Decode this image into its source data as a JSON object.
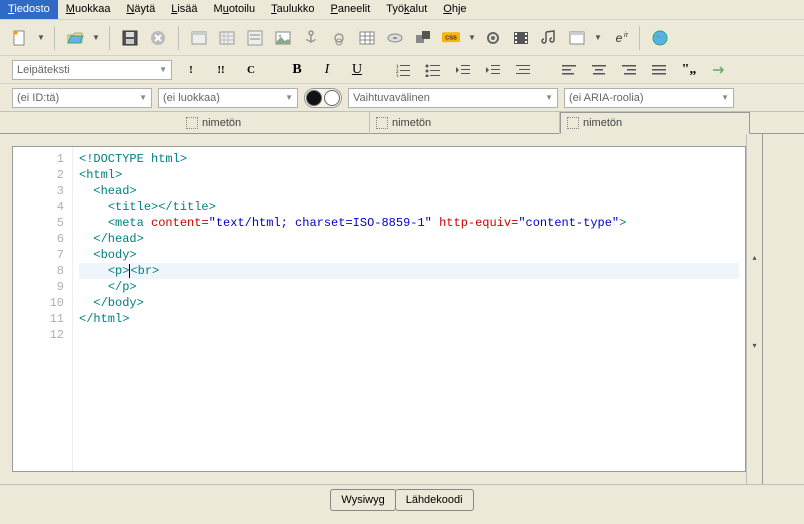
{
  "menubar": [
    {
      "label": "Tiedosto",
      "u": 0,
      "active": true
    },
    {
      "label": "Muokkaa",
      "u": 0
    },
    {
      "label": "Näytä",
      "u": 0
    },
    {
      "label": "Lisää",
      "u": 0
    },
    {
      "label": "Muotoilu",
      "u": 1
    },
    {
      "label": "Taulukko",
      "u": 0
    },
    {
      "label": "Paneelit",
      "u": 0
    },
    {
      "label": "Työkalut",
      "u": 3
    },
    {
      "label": "Ohje",
      "u": 0
    }
  ],
  "paragraph_style": "Leipäteksti",
  "id_field": "(ei ID:tä)",
  "class_field": "(ei luokkaa)",
  "width_field": "Vaihtuvavälinen",
  "aria_field": "(ei ARIA-roolia)",
  "tabs": [
    "nimetön",
    "nimetön",
    "nimetön"
  ],
  "active_tab": 2,
  "bottom_buttons": [
    "Wysiwyg",
    "Lähdekoodi"
  ],
  "code_lines": [
    {
      "n": 1,
      "html": "&lt;!DOCTYPE html&gt;",
      "cls": "tag"
    },
    {
      "n": 2,
      "html": "<span class='tag'>&lt;html&gt;</span>"
    },
    {
      "n": 3,
      "html": "  <span class='tag'>&lt;head&gt;</span>"
    },
    {
      "n": 4,
      "html": "    <span class='tag'>&lt;title&gt;&lt;/title&gt;</span>"
    },
    {
      "n": 5,
      "html": "    <span class='tag'>&lt;meta</span> <span class='attr'>content=</span><span class='str'>\"text/html; charset=ISO-8859-1\"</span> <span class='attr'>http-equiv=</span><span class='str'>\"content-type\"</span><span class='tag'>&gt;</span>"
    },
    {
      "n": 6,
      "html": "  <span class='tag'>&lt;/head&gt;</span>"
    },
    {
      "n": 7,
      "html": "  <span class='tag'>&lt;body&gt;</span>"
    },
    {
      "n": 8,
      "html": "    <span class='tag'>&lt;p&gt;</span><span class='cursor'></span><span class='tag'>&lt;br&gt;</span>",
      "hl": true
    },
    {
      "n": 9,
      "html": "    <span class='tag'>&lt;/p&gt;</span>"
    },
    {
      "n": 10,
      "html": "  <span class='tag'>&lt;/body&gt;</span>"
    },
    {
      "n": 11,
      "html": "<span class='tag'>&lt;/html&gt;</span>"
    },
    {
      "n": 12,
      "html": ""
    }
  ]
}
